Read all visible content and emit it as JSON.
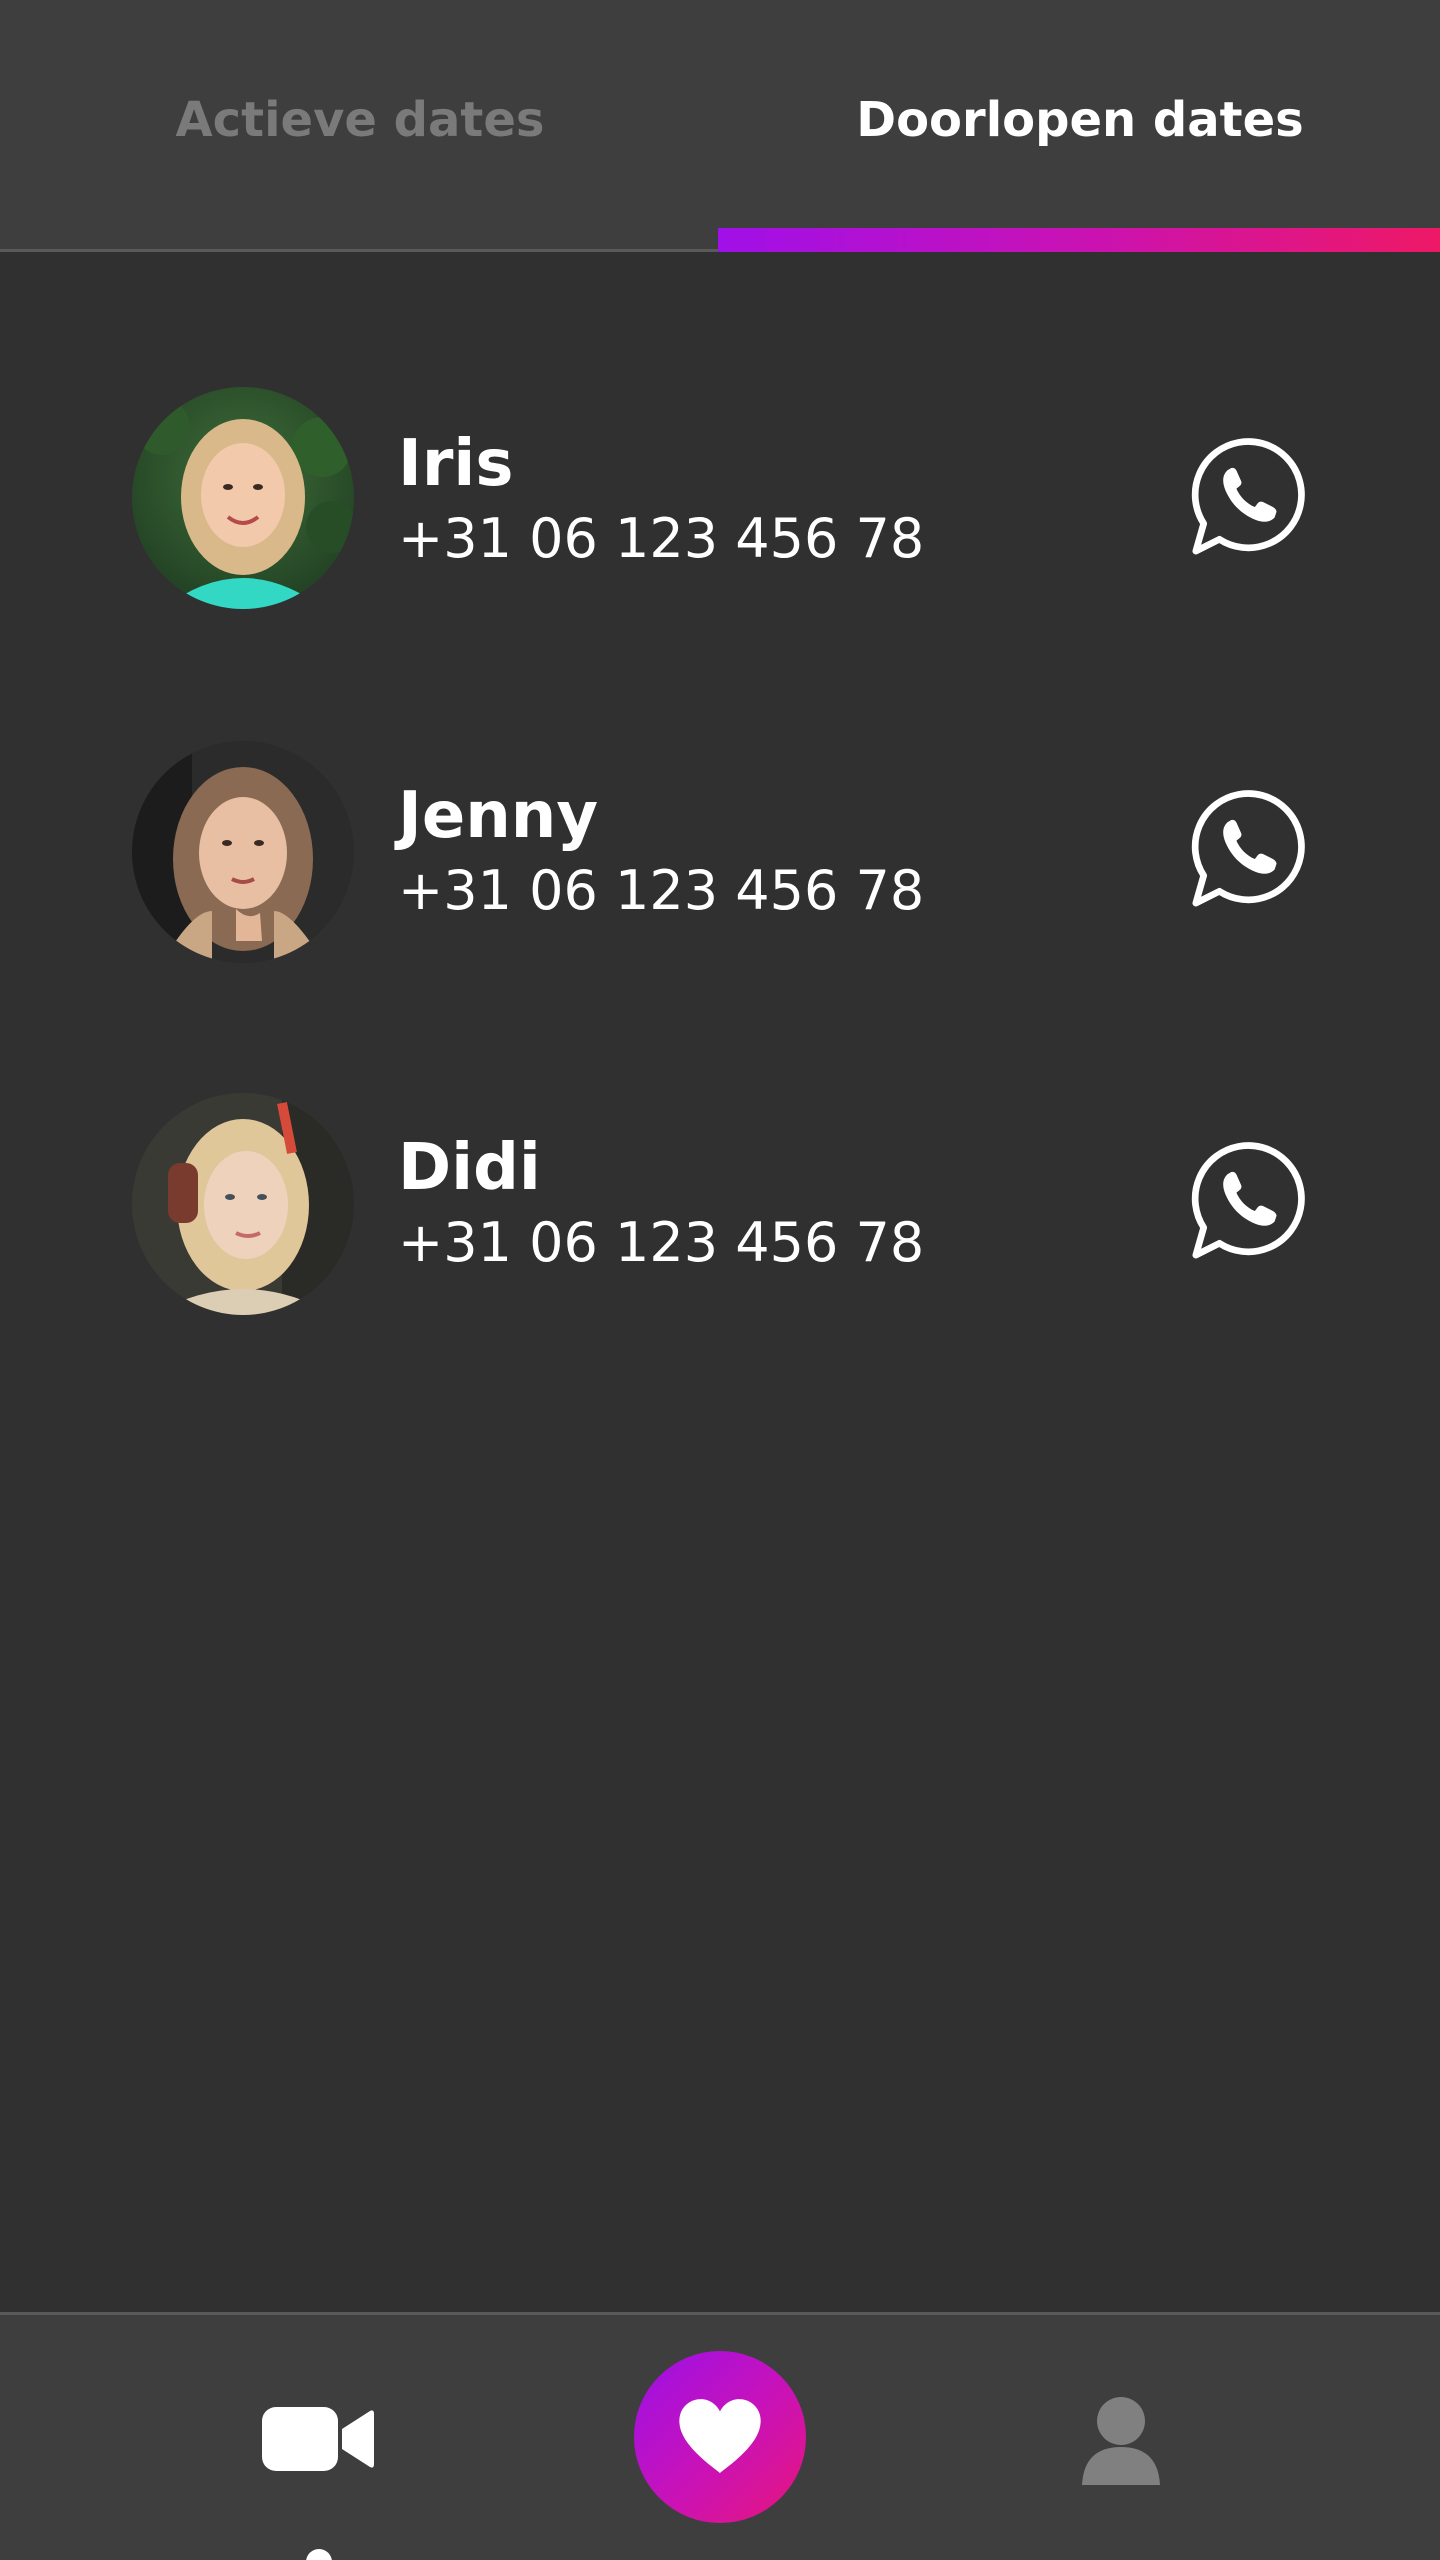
{
  "tabs": {
    "active_label": "Actieve dates",
    "past_label": "Doorlopen dates",
    "selected": "Doorlopen dates"
  },
  "contacts": [
    {
      "name": "Iris",
      "phone": "+31 06 123 456 78",
      "action_icon": "whatsapp-icon"
    },
    {
      "name": "Jenny",
      "phone": "+31 06 123 456 78",
      "action_icon": "whatsapp-icon"
    },
    {
      "name": "Didi",
      "phone": "+31 06 123 456 78",
      "action_icon": "whatsapp-icon"
    }
  ],
  "bottom_nav": {
    "items": [
      {
        "icon": "video-camera-icon",
        "selected": true
      },
      {
        "icon": "heart-icon",
        "selected": false
      },
      {
        "icon": "profile-icon",
        "selected": false
      }
    ]
  },
  "colors": {
    "background": "#303030",
    "bar_background": "#3e3e3e",
    "accent_gradient_start": "#a010e8",
    "accent_gradient_end": "#ee1866",
    "inactive_text": "#7a7a7a"
  }
}
